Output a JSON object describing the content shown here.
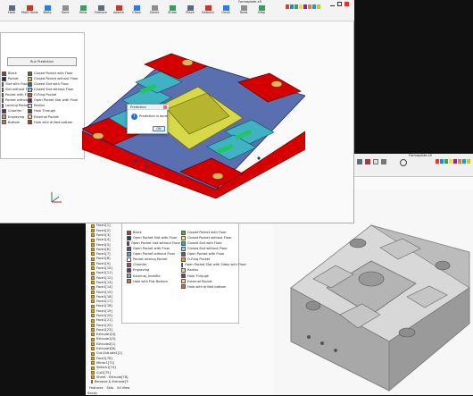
{
  "back_window": {
    "ribbon_labels": [
      "Hole",
      "Mold Tools",
      "Body",
      "Save",
      "View",
      "Feature",
      "Assem",
      "Close",
      "Smart",
      "Show",
      "Place",
      "Rebuild",
      "Undo",
      "Tools",
      "Help"
    ],
    "title_center": "Formaplate.x5",
    "palette_colors": [
      "#e53935",
      "#1e88e5",
      "#43a047",
      "#fdd835",
      "#8e24aa",
      "#ff7043",
      "#00acc1",
      "#c0ca33"
    ],
    "legend_left": [
      "Block",
      "Open Pocket Slot with Floor",
      "Open Pocket slot without Floor",
      "Open Pocket with Floor",
      "Open Pocket without Floor",
      "Pocket locking Pocket",
      "Chamfer",
      "Engraving",
      "External_fromfile",
      "Hole with Flat Bottom"
    ],
    "legend_left_colors": [
      "#d32f2f",
      "#283593",
      "#0d47a1",
      "#1565c0",
      "#42a5f5",
      "#ffffff",
      "#e91e63",
      "#7b1fa2",
      "#9e9e9e",
      "#ef6c00"
    ],
    "legend_right": [
      "Closed Pocket with Floor",
      "Closed Pocket without Floor",
      "Closed Slot with Floor",
      "Closed Slot without Floor",
      "Open Pocket with Floor",
      "O-Ring Pocket",
      "Open Pocket Slot with Sides with Floor",
      "Radius",
      "Hole Through",
      "External Pocket",
      "Hole with drilled bottom"
    ],
    "legend_right_colors": [
      "#4caf50",
      "#ffeb3b",
      "#00bcd4",
      "#80deea",
      "#795548",
      "#ff9800",
      "#9c27b0",
      "#c5e1a5",
      "#6d4c41",
      "#ffcc80",
      "#ff5722"
    ],
    "tree_items": [
      "Face1[1]",
      "Face1[2]",
      "Face1[3]",
      "Face1[4]",
      "Face1[5]",
      "Face1[6]",
      "Face1[7]",
      "Face1[8]",
      "Face1[9]",
      "Face1[10]",
      "Face1[11]",
      "Face1[12]",
      "Face1[13]",
      "Face1[14]",
      "Face1[15]",
      "Face1[16]",
      "Face1[17]",
      "Face1[18]",
      "Face1[19]",
      "Face1[20]",
      "Face1[21]",
      "Face1[22]",
      "Face1[23]",
      "Extrude1[4]",
      "Extrude1[5]",
      "Extrude2[1]",
      "Extrude3[6]",
      "Cut-Extrude1[1]",
      "Face1[78]",
      "Mirror1[71]",
      "Sketch1[74]",
      "Cut1[75]",
      "Sheet - Extrude[78]",
      "Remove & Extrude[79]"
    ],
    "bottom_tabs": [
      "Features",
      "Skts",
      "All View"
    ],
    "status": "Ready"
  },
  "front_window": {
    "title_center": "Formaplate.x5",
    "run_button": "Run Prediction",
    "legend_items": [
      "Closed Pocket with Floor",
      "Closed Pocket without Floor",
      "Closed Slot with Floor",
      "Closed Slot without Floor",
      "O-Ring Pocket",
      "Open Pocket Slot with Floor",
      "Radius",
      "Hole Through",
      "External Pocket",
      "Hole with drilled bottom"
    ],
    "legend_colors": [
      "#2e7d32",
      "#f9a825",
      "#00838f",
      "#80cbc4",
      "#e65100",
      "#6a1b9a",
      "#c5e1a5",
      "#5d4037",
      "#ffcc80",
      "#bf360c"
    ],
    "left_items": [
      "Block",
      "Pocket",
      "Slot with Floor",
      "Slot without Floor",
      "Pocket with Floor",
      "Pocket without",
      "Locking Pocket",
      "Chamfer",
      "Engraving",
      "Bottom"
    ],
    "left_colors": [
      "#c62828",
      "#1a237e",
      "#283593",
      "#1565c0",
      "#0d47a1",
      "#ffffff",
      "#ad1457",
      "#6a1b9a",
      "#9e9e9e",
      "#ef6c00"
    ],
    "dialog_title": "Prediction",
    "dialog_text": "Prediction is done",
    "dialog_ok": "OK"
  }
}
